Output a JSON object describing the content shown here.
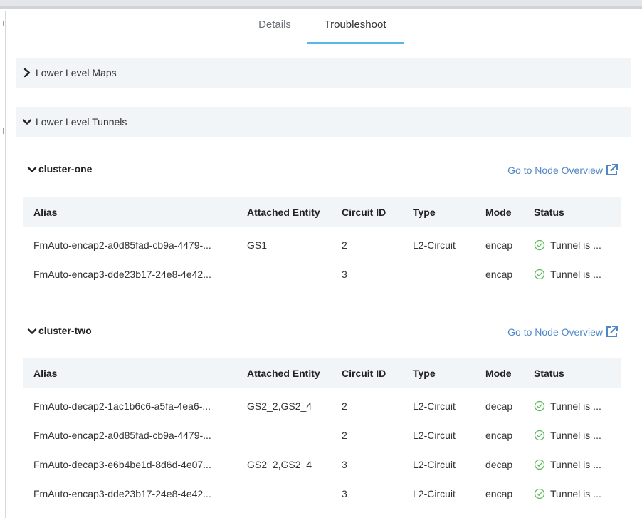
{
  "tabs": [
    {
      "label": "Details",
      "active": false
    },
    {
      "label": "Troubleshoot",
      "active": true
    }
  ],
  "sections": {
    "maps": {
      "label": "Lower Level Maps",
      "expanded": false
    },
    "tunnels": {
      "label": "Lower Level Tunnels",
      "expanded": true
    }
  },
  "columns": [
    "Alias",
    "Attached Entity",
    "Circuit ID",
    "Type",
    "Mode",
    "Status"
  ],
  "clusters": [
    {
      "name": "cluster-one",
      "link_label": "Go to Node Overview",
      "rows": [
        {
          "alias": "FmAuto-encap2-a0d85fad-cb9a-4479-...",
          "entity": "GS1",
          "circuit_id": "2",
          "type": "L2-Circuit",
          "mode": "encap",
          "status": "Tunnel is ..."
        },
        {
          "alias": "FmAuto-encap3-dde23b17-24e8-4e42...",
          "entity": "",
          "circuit_id": "3",
          "type": "",
          "mode": "encap",
          "status": "Tunnel is ..."
        }
      ]
    },
    {
      "name": "cluster-two",
      "link_label": "Go to Node Overview",
      "rows": [
        {
          "alias": "FmAuto-decap2-1ac1b6c6-a5fa-4ea6-...",
          "entity": "GS2_2,GS2_4",
          "circuit_id": "2",
          "type": "L2-Circuit",
          "mode": "decap",
          "status": "Tunnel is ..."
        },
        {
          "alias": "FmAuto-encap2-a0d85fad-cb9a-4479-...",
          "entity": "",
          "circuit_id": "2",
          "type": "L2-Circuit",
          "mode": "encap",
          "status": "Tunnel is ..."
        },
        {
          "alias": "FmAuto-decap3-e6b4be1d-8d6d-4e07...",
          "entity": "GS2_2,GS2_4",
          "circuit_id": "3",
          "type": "L2-Circuit",
          "mode": "decap",
          "status": "Tunnel is ..."
        },
        {
          "alias": "FmAuto-encap3-dde23b17-24e8-4e42...",
          "entity": "",
          "circuit_id": "3",
          "type": "L2-Circuit",
          "mode": "encap",
          "status": "Tunnel is ..."
        }
      ]
    }
  ],
  "colors": {
    "accent": "#55b8e8",
    "link": "#4f87c5",
    "success": "#5cb85c",
    "header_bg": "#f2f5f8"
  },
  "icons": {
    "section_collapsed": "chevron-right-icon",
    "section_expanded": "chevron-down-icon",
    "external_link": "external-link-icon",
    "status_ok": "check-circle-icon"
  }
}
